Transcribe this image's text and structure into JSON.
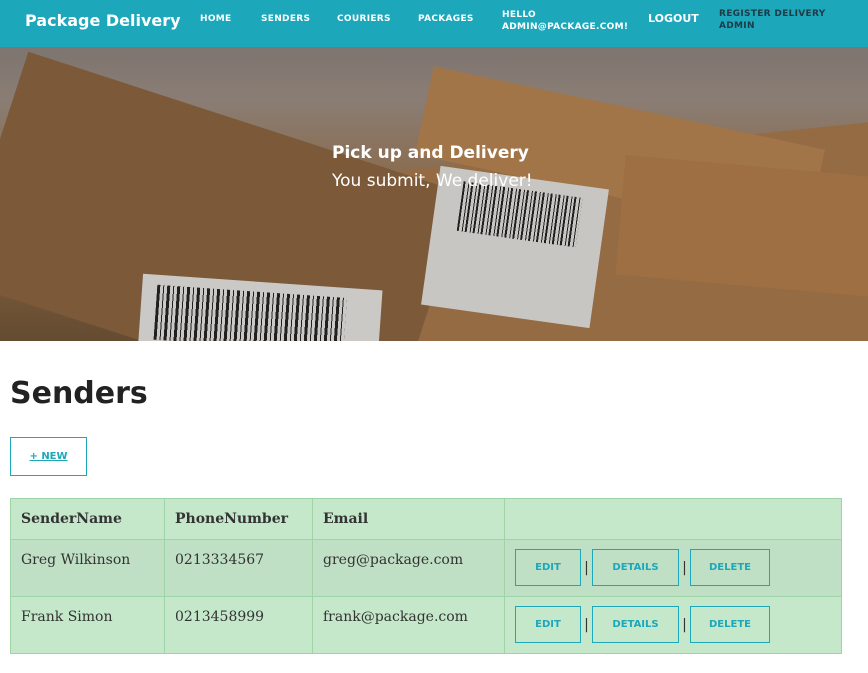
{
  "navbar": {
    "brand": "Package Delivery",
    "links": [
      "HOME",
      "SENDERS",
      "COURIERS",
      "PACKAGES"
    ],
    "hello_line1": "HELLO",
    "hello_line2": "ADMIN@PACKAGE.COM!",
    "logout": "LOGOUT",
    "register_line1": "REGISTER DELIVERY",
    "register_line2": "ADMIN"
  },
  "hero": {
    "title": "Pick up and Delivery",
    "subtitle": "You submit, We deliver!"
  },
  "page": {
    "title": "Senders",
    "new_button": "+ NEW"
  },
  "table": {
    "headers": [
      "SenderName",
      "PhoneNumber",
      "Email",
      ""
    ],
    "rows": [
      {
        "name": "Greg Wilkinson",
        "phone": "0213334567",
        "email": "greg@package.com"
      },
      {
        "name": "Frank Simon",
        "phone": "0213458999",
        "email": "frank@package.com"
      }
    ],
    "actions": {
      "edit": "EDIT",
      "details": "DETAILS",
      "delete": "DELETE",
      "separator": "|"
    }
  }
}
